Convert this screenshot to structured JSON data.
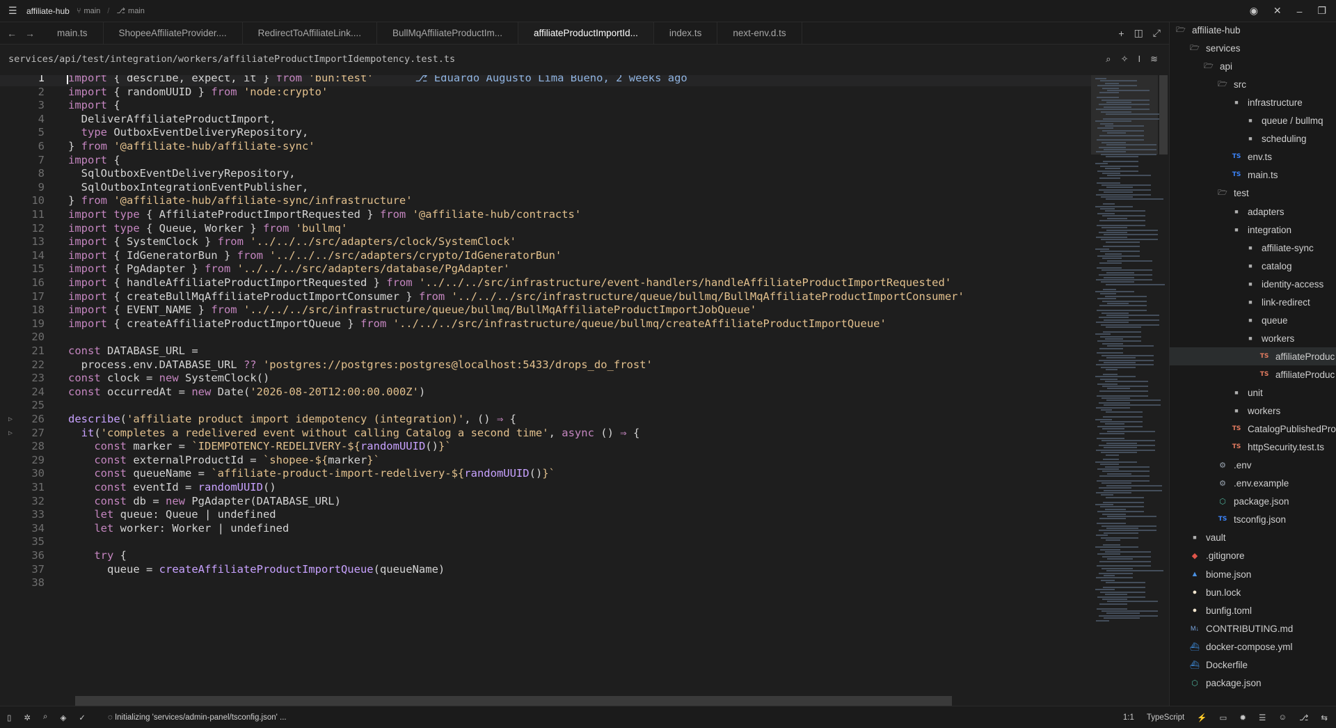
{
  "titlebar": {
    "project": "affiliate-hub",
    "branch1": "main",
    "branch2": "main"
  },
  "tabs": [
    {
      "label": "main.ts",
      "active": false
    },
    {
      "label": "ShopeeAffiliateProvider....",
      "active": false
    },
    {
      "label": "RedirectToAffiliateLink....",
      "active": false
    },
    {
      "label": "BullMqAffiliateProductIm...",
      "active": false
    },
    {
      "label": "affiliateProductImportId...",
      "active": true
    },
    {
      "label": "index.ts",
      "active": false
    },
    {
      "label": "next-env.d.ts",
      "active": false
    }
  ],
  "breadcrumb": {
    "path": "services/api/test/integration/workers/affiliateProductImportIdempotency.test.ts"
  },
  "editor": {
    "current_line": 1,
    "blame": "Eduardo Augusto Lima Bueno, 2 weeks ago",
    "folded_lines": [
      26,
      27
    ],
    "lines": [
      [
        [
          "k",
          "import"
        ],
        [
          "v",
          " { describe, expect, it } "
        ],
        [
          "k",
          "from"
        ],
        [
          "s",
          " 'bun:test'"
        ]
      ],
      [
        [
          "k",
          "import"
        ],
        [
          "v",
          " { randomUUID } "
        ],
        [
          "k",
          "from"
        ],
        [
          "s",
          " 'node:crypto'"
        ]
      ],
      [
        [
          "k",
          "import"
        ],
        [
          "v",
          " {"
        ]
      ],
      [
        [
          "v",
          "  DeliverAffiliateProductImport,"
        ]
      ],
      [
        [
          "v",
          "  "
        ],
        [
          "k",
          "type"
        ],
        [
          "v",
          " OutboxEventDeliveryRepository,"
        ]
      ],
      [
        [
          "v",
          "} "
        ],
        [
          "k",
          "from"
        ],
        [
          "s",
          " '@affiliate-hub/affiliate-sync'"
        ]
      ],
      [
        [
          "k",
          "import"
        ],
        [
          "v",
          " {"
        ]
      ],
      [
        [
          "v",
          "  SqlOutboxEventDeliveryRepository,"
        ]
      ],
      [
        [
          "v",
          "  SqlOutboxIntegrationEventPublisher,"
        ]
      ],
      [
        [
          "v",
          "} "
        ],
        [
          "k",
          "from"
        ],
        [
          "s",
          " '@affiliate-hub/affiliate-sync/infrastructure'"
        ]
      ],
      [
        [
          "k",
          "import type"
        ],
        [
          "v",
          " { AffiliateProductImportRequested } "
        ],
        [
          "k",
          "from"
        ],
        [
          "s",
          " '@affiliate-hub/contracts'"
        ]
      ],
      [
        [
          "k",
          "import type"
        ],
        [
          "v",
          " { Queue, Worker } "
        ],
        [
          "k",
          "from"
        ],
        [
          "s",
          " 'bullmq'"
        ]
      ],
      [
        [
          "k",
          "import"
        ],
        [
          "v",
          " { SystemClock } "
        ],
        [
          "k",
          "from"
        ],
        [
          "s",
          " '../../../src/adapters/clock/SystemClock'"
        ]
      ],
      [
        [
          "k",
          "import"
        ],
        [
          "v",
          " { IdGeneratorBun } "
        ],
        [
          "k",
          "from"
        ],
        [
          "s",
          " '../../../src/adapters/crypto/IdGeneratorBun'"
        ]
      ],
      [
        [
          "k",
          "import"
        ],
        [
          "v",
          " { PgAdapter } "
        ],
        [
          "k",
          "from"
        ],
        [
          "s",
          " '../../../src/adapters/database/PgAdapter'"
        ]
      ],
      [
        [
          "k",
          "import"
        ],
        [
          "v",
          " { handleAffiliateProductImportRequested } "
        ],
        [
          "k",
          "from"
        ],
        [
          "s",
          " '../../../src/infrastructure/event-handlers/handleAffiliateProductImportRequested'"
        ]
      ],
      [
        [
          "k",
          "import"
        ],
        [
          "v",
          " { createBullMqAffiliateProductImportConsumer } "
        ],
        [
          "k",
          "from"
        ],
        [
          "s",
          " '../../../src/infrastructure/queue/bullmq/BullMqAffiliateProductImportConsumer'"
        ]
      ],
      [
        [
          "k",
          "import"
        ],
        [
          "v",
          " { EVENT_NAME } "
        ],
        [
          "k",
          "from"
        ],
        [
          "s",
          " '../../../src/infrastructure/queue/bullmq/BullMqAffiliateProductImportJobQueue'"
        ]
      ],
      [
        [
          "k",
          "import"
        ],
        [
          "v",
          " { createAffiliateProductImportQueue } "
        ],
        [
          "k",
          "from"
        ],
        [
          "s",
          " '../../../src/infrastructure/queue/bullmq/createAffiliateProductImportQueue'"
        ]
      ],
      [
        [
          "v",
          ""
        ]
      ],
      [
        [
          "k",
          "const"
        ],
        [
          "v",
          " DATABASE_URL ="
        ]
      ],
      [
        [
          "v",
          "  process.env.DATABASE_URL "
        ],
        [
          "op",
          "??"
        ],
        [
          "s",
          " 'postgres://postgres:postgres@localhost:5433/drops_do_frost'"
        ]
      ],
      [
        [
          "k",
          "const"
        ],
        [
          "v",
          " clock = "
        ],
        [
          "k",
          "new"
        ],
        [
          "v",
          " SystemClock()"
        ]
      ],
      [
        [
          "k",
          "const"
        ],
        [
          "v",
          " occurredAt = "
        ],
        [
          "k",
          "new"
        ],
        [
          "v",
          " Date("
        ],
        [
          "s",
          "'2026-08-20T12:00:00.000Z'"
        ],
        [
          "v",
          ")"
        ]
      ],
      [
        [
          "v",
          ""
        ]
      ],
      [
        [
          "fn",
          "describe"
        ],
        [
          "v",
          "("
        ],
        [
          "s",
          "'affiliate product import idempotency (integration)'"
        ],
        [
          "v",
          ", () "
        ],
        [
          "op",
          "⇒"
        ],
        [
          "v",
          " {"
        ]
      ],
      [
        [
          "v",
          "  "
        ],
        [
          "fn",
          "it"
        ],
        [
          "v",
          "("
        ],
        [
          "s",
          "'completes a redelivered event without calling Catalog a second time'"
        ],
        [
          "v",
          ", "
        ],
        [
          "k",
          "async"
        ],
        [
          "v",
          " () "
        ],
        [
          "op",
          "⇒"
        ],
        [
          "v",
          " {"
        ]
      ],
      [
        [
          "v",
          "    "
        ],
        [
          "k",
          "const"
        ],
        [
          "v",
          " marker = "
        ],
        [
          "s",
          "`IDEMPOTENCY-REDELIVERY-${"
        ],
        [
          "fn",
          "randomUUID"
        ],
        [
          "v",
          "()"
        ],
        [
          "s",
          "}`"
        ]
      ],
      [
        [
          "v",
          "    "
        ],
        [
          "k",
          "const"
        ],
        [
          "v",
          " externalProductId = "
        ],
        [
          "s",
          "`shopee-${"
        ],
        [
          "v",
          "marker"
        ],
        [
          "s",
          "}`"
        ]
      ],
      [
        [
          "v",
          "    "
        ],
        [
          "k",
          "const"
        ],
        [
          "v",
          " queueName = "
        ],
        [
          "s",
          "`affiliate-product-import-redelivery-${"
        ],
        [
          "fn",
          "randomUUID"
        ],
        [
          "v",
          "()"
        ],
        [
          "s",
          "}`"
        ]
      ],
      [
        [
          "v",
          "    "
        ],
        [
          "k",
          "const"
        ],
        [
          "v",
          " eventId = "
        ],
        [
          "fn",
          "randomUUID"
        ],
        [
          "v",
          "()"
        ]
      ],
      [
        [
          "v",
          "    "
        ],
        [
          "k",
          "const"
        ],
        [
          "v",
          " db = "
        ],
        [
          "k",
          "new"
        ],
        [
          "v",
          " PgAdapter(DATABASE_URL)"
        ]
      ],
      [
        [
          "v",
          "    "
        ],
        [
          "k",
          "let"
        ],
        [
          "v",
          " queue: Queue | undefined"
        ]
      ],
      [
        [
          "v",
          "    "
        ],
        [
          "k",
          "let"
        ],
        [
          "v",
          " worker: Worker | undefined"
        ]
      ],
      [
        [
          "v",
          ""
        ]
      ],
      [
        [
          "v",
          "    "
        ],
        [
          "k",
          "try"
        ],
        [
          "v",
          " {"
        ]
      ],
      [
        [
          "v",
          "      queue = "
        ],
        [
          "fn",
          "createAffiliateProductImportQueue"
        ],
        [
          "v",
          "(queueName)"
        ]
      ],
      [
        [
          "v",
          ""
        ]
      ]
    ]
  },
  "sidebar": {
    "items": [
      {
        "label": "affiliate-hub",
        "icon": "folder-open-icon",
        "depth": 0,
        "kind": "folder-open"
      },
      {
        "label": "services",
        "icon": "folder-open-icon",
        "depth": 1,
        "kind": "folder-open"
      },
      {
        "label": "api",
        "icon": "folder-open-icon",
        "depth": 2,
        "kind": "folder-open"
      },
      {
        "label": "src",
        "icon": "folder-open-icon",
        "depth": 3,
        "kind": "folder-open"
      },
      {
        "label": "infrastructure",
        "icon": "folder-icon",
        "depth": 4,
        "kind": "folder"
      },
      {
        "label": "queue / bullmq",
        "icon": "folder-icon",
        "depth": 5,
        "kind": "folder"
      },
      {
        "label": "scheduling",
        "icon": "folder-icon",
        "depth": 5,
        "kind": "folder"
      },
      {
        "label": "env.ts",
        "icon": "typescript-icon",
        "depth": 4,
        "kind": "ts"
      },
      {
        "label": "main.ts",
        "icon": "typescript-icon",
        "depth": 4,
        "kind": "ts"
      },
      {
        "label": "test",
        "icon": "folder-open-icon",
        "depth": 3,
        "kind": "folder-open"
      },
      {
        "label": "adapters",
        "icon": "folder-icon",
        "depth": 4,
        "kind": "folder"
      },
      {
        "label": "integration",
        "icon": "folder-icon",
        "depth": 4,
        "kind": "folder"
      },
      {
        "label": "affiliate-sync",
        "icon": "folder-icon",
        "depth": 5,
        "kind": "folder"
      },
      {
        "label": "catalog",
        "icon": "folder-icon",
        "depth": 5,
        "kind": "folder"
      },
      {
        "label": "identity-access",
        "icon": "folder-icon",
        "depth": 5,
        "kind": "folder"
      },
      {
        "label": "link-redirect",
        "icon": "folder-icon",
        "depth": 5,
        "kind": "folder"
      },
      {
        "label": "queue",
        "icon": "folder-icon",
        "depth": 5,
        "kind": "folder"
      },
      {
        "label": "workers",
        "icon": "folder-icon",
        "depth": 5,
        "kind": "folder"
      },
      {
        "label": "affiliateProduc",
        "icon": "typescript-test-icon",
        "depth": 6,
        "kind": "ts-test",
        "selected": true
      },
      {
        "label": "affiliateProduc",
        "icon": "typescript-test-icon",
        "depth": 6,
        "kind": "ts-test"
      },
      {
        "label": "unit",
        "icon": "folder-icon",
        "depth": 4,
        "kind": "folder"
      },
      {
        "label": "workers",
        "icon": "folder-icon",
        "depth": 4,
        "kind": "folder"
      },
      {
        "label": "CatalogPublishedPro",
        "icon": "typescript-test-icon",
        "depth": 4,
        "kind": "ts-test"
      },
      {
        "label": "httpSecurity.test.ts",
        "icon": "typescript-test-icon",
        "depth": 4,
        "kind": "ts-test"
      },
      {
        "label": ".env",
        "icon": "gear-icon",
        "depth": 3,
        "kind": "gear"
      },
      {
        "label": ".env.example",
        "icon": "gear-icon",
        "depth": 3,
        "kind": "gear"
      },
      {
        "label": "package.json",
        "icon": "package-icon",
        "depth": 3,
        "kind": "pkg"
      },
      {
        "label": "tsconfig.json",
        "icon": "tsconfig-icon",
        "depth": 3,
        "kind": "ts"
      },
      {
        "label": "vault",
        "icon": "folder-icon",
        "depth": 1,
        "kind": "folder"
      },
      {
        "label": ".gitignore",
        "icon": "git-icon",
        "depth": 1,
        "kind": "git"
      },
      {
        "label": "biome.json",
        "icon": "biome-icon",
        "depth": 1,
        "kind": "biome"
      },
      {
        "label": "bun.lock",
        "icon": "bun-icon",
        "depth": 1,
        "kind": "bun"
      },
      {
        "label": "bunfig.toml",
        "icon": "bun-icon",
        "depth": 1,
        "kind": "bun"
      },
      {
        "label": "CONTRIBUTING.md",
        "icon": "markdown-icon",
        "depth": 1,
        "kind": "md"
      },
      {
        "label": "docker-compose.yml",
        "icon": "docker-icon",
        "depth": 1,
        "kind": "docker"
      },
      {
        "label": "Dockerfile",
        "icon": "docker-icon",
        "depth": 1,
        "kind": "docker"
      },
      {
        "label": "package.json",
        "icon": "package-icon",
        "depth": 1,
        "kind": "pkg"
      }
    ]
  },
  "statusbar": {
    "message": "Initializing 'services/admin-panel/tsconfig.json' ...",
    "position": "1:1",
    "language": "TypeScript"
  }
}
